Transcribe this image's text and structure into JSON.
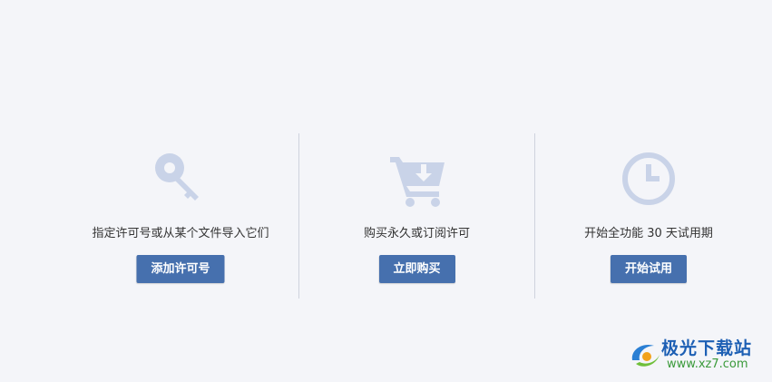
{
  "options": [
    {
      "icon": "key-icon",
      "description": "指定许可号或从某个文件导入它们",
      "button_label": "添加许可号"
    },
    {
      "icon": "shopping-cart-icon",
      "description": "购买永久或订阅许可",
      "button_label": "立即购买"
    },
    {
      "icon": "clock-icon",
      "description": "开始全功能 30 天试用期",
      "button_label": "开始试用"
    }
  ],
  "watermark": {
    "title": "极光下载站",
    "url": "www.xz7.com"
  },
  "colors": {
    "background": "#f4f5f9",
    "button": "#4670ae",
    "icon": "#c9d3e8",
    "text": "#333333"
  }
}
